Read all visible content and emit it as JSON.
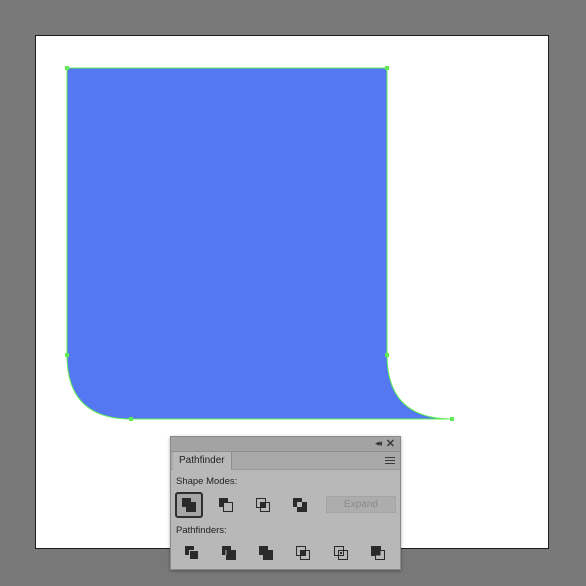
{
  "canvas": {
    "shape_fill": "#5577f2",
    "selection_color": "#5dec54"
  },
  "panel": {
    "tab_label": "Pathfinder",
    "collapse_glyph": "◂◂",
    "close_glyph": "✕",
    "shape_modes_label": "Shape Modes:",
    "pathfinders_label": "Pathfinders:",
    "expand_label": "Expand",
    "shape_mode_buttons": [
      "unite-icon",
      "minus-front-icon",
      "intersect-icon",
      "exclude-icon"
    ],
    "pathfinder_buttons": [
      "divide-icon",
      "trim-icon",
      "merge-icon",
      "crop-icon",
      "outline-icon",
      "minus-back-icon"
    ]
  }
}
